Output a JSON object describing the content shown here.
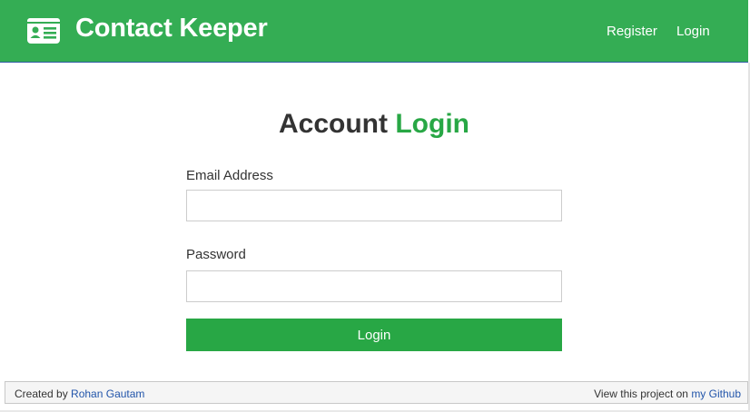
{
  "navbar": {
    "brand_icon": "id-card-icon",
    "title": "Contact Keeper",
    "links": {
      "register": "Register",
      "login": "Login"
    },
    "background": "#34ad54"
  },
  "main": {
    "heading_prefix": "Account",
    "heading_accent": "Login",
    "email_label": "Email Address",
    "email_value": "",
    "password_label": "Password",
    "password_value": "",
    "submit_label": "Login",
    "accent_color": "#28a745"
  },
  "footer": {
    "created_by_text": "Created by",
    "author_link": "Rohan Gautam",
    "view_text": "View this project on",
    "github_link": "my Github"
  }
}
